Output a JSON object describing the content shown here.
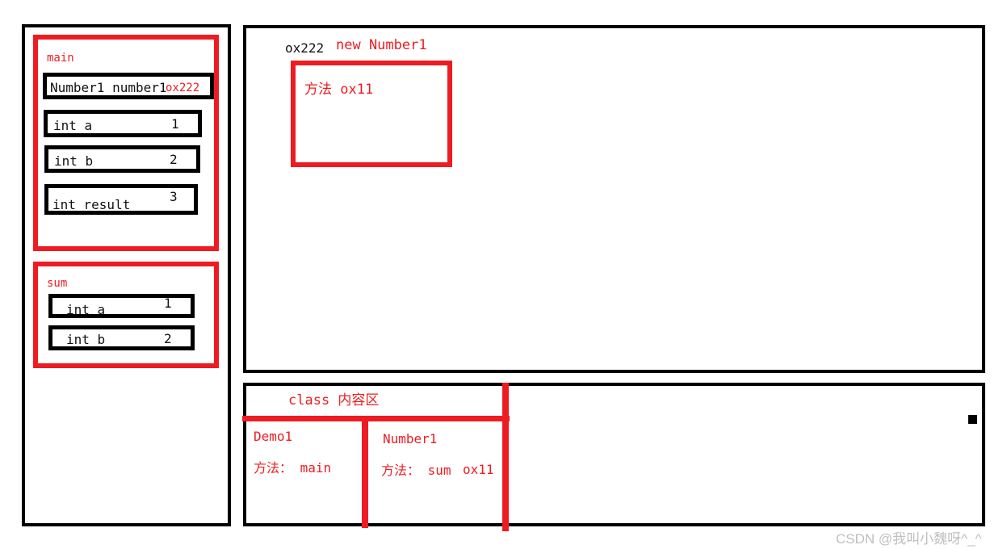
{
  "meta": {
    "watermark": "CSDN @我叫小魏呀^_^"
  },
  "stack_panel": {
    "name": "stack-panel",
    "frames": [
      {
        "title": "main",
        "rows": [
          {
            "name": "Number1 number1",
            "value": "ox222",
            "value_color": "#ee1c22"
          },
          {
            "name": "int a",
            "value": "1",
            "value_color": "#111111"
          },
          {
            "name": "int b",
            "value": "2",
            "value_color": "#111111"
          },
          {
            "name": "int result",
            "value": "3",
            "value_color": "#111111"
          }
        ]
      },
      {
        "title": "sum",
        "rows": [
          {
            "name": "int a",
            "value": "1",
            "value_color": "#111111"
          },
          {
            "name": "int b",
            "value": "2",
            "value_color": "#111111"
          }
        ]
      }
    ]
  },
  "heap_panel": {
    "address_label": "ox222",
    "object_label": "new Number1",
    "object_body": "方法 ox11"
  },
  "class_panel": {
    "title": "class 内容区",
    "columns": [
      {
        "class_name": "Demo1",
        "methods": "方法： main",
        "address": ""
      },
      {
        "class_name": "Number1",
        "methods": "方法： sum",
        "address": "ox11"
      }
    ]
  },
  "colors": {
    "red": "#ee1c22",
    "black": "#000000",
    "watermark_gray": "#bfbfbf"
  }
}
